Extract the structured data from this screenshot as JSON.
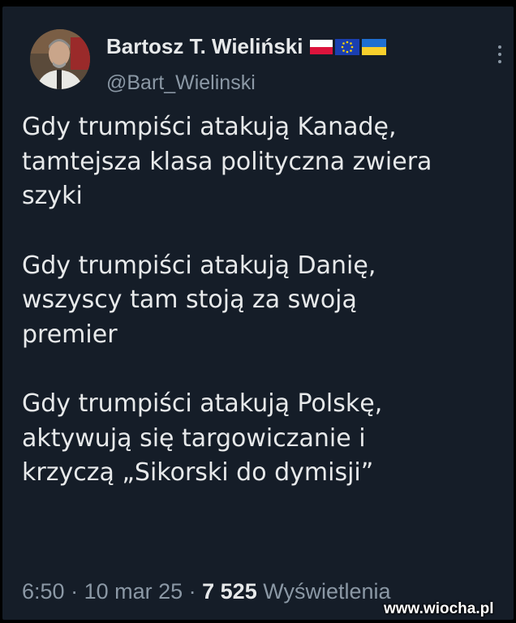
{
  "author": {
    "display_name": "Bartosz T. Wieliński",
    "handle": "@Bart_Wielinski",
    "flags": [
      "poland-flag-icon",
      "eu-flag-icon",
      "ukraine-flag-icon"
    ],
    "avatar_icon": "avatar-photo"
  },
  "tweet": {
    "paragraphs": [
      "Gdy trumpiści atakują Kanadę,\ntamtejsza klasa polityczna zwiera\nszyki",
      "Gdy trumpiści atakują Danię,\nwszyscy tam stoją za swoją\npremier",
      "Gdy trumpiści atakują Polskę,\naktywują się targowiczanie i\nkrzyczą „Sikorski do dymisji”"
    ]
  },
  "meta": {
    "time": "6:50",
    "separator": " · ",
    "date": "10 mar 25",
    "views_count": "7 525",
    "views_label": "Wyświetlenia"
  },
  "watermark": "www.wiocha.pl",
  "colors": {
    "background": "#151d28",
    "text_primary": "#e7e9ea",
    "text_secondary": "#8b98a5"
  }
}
